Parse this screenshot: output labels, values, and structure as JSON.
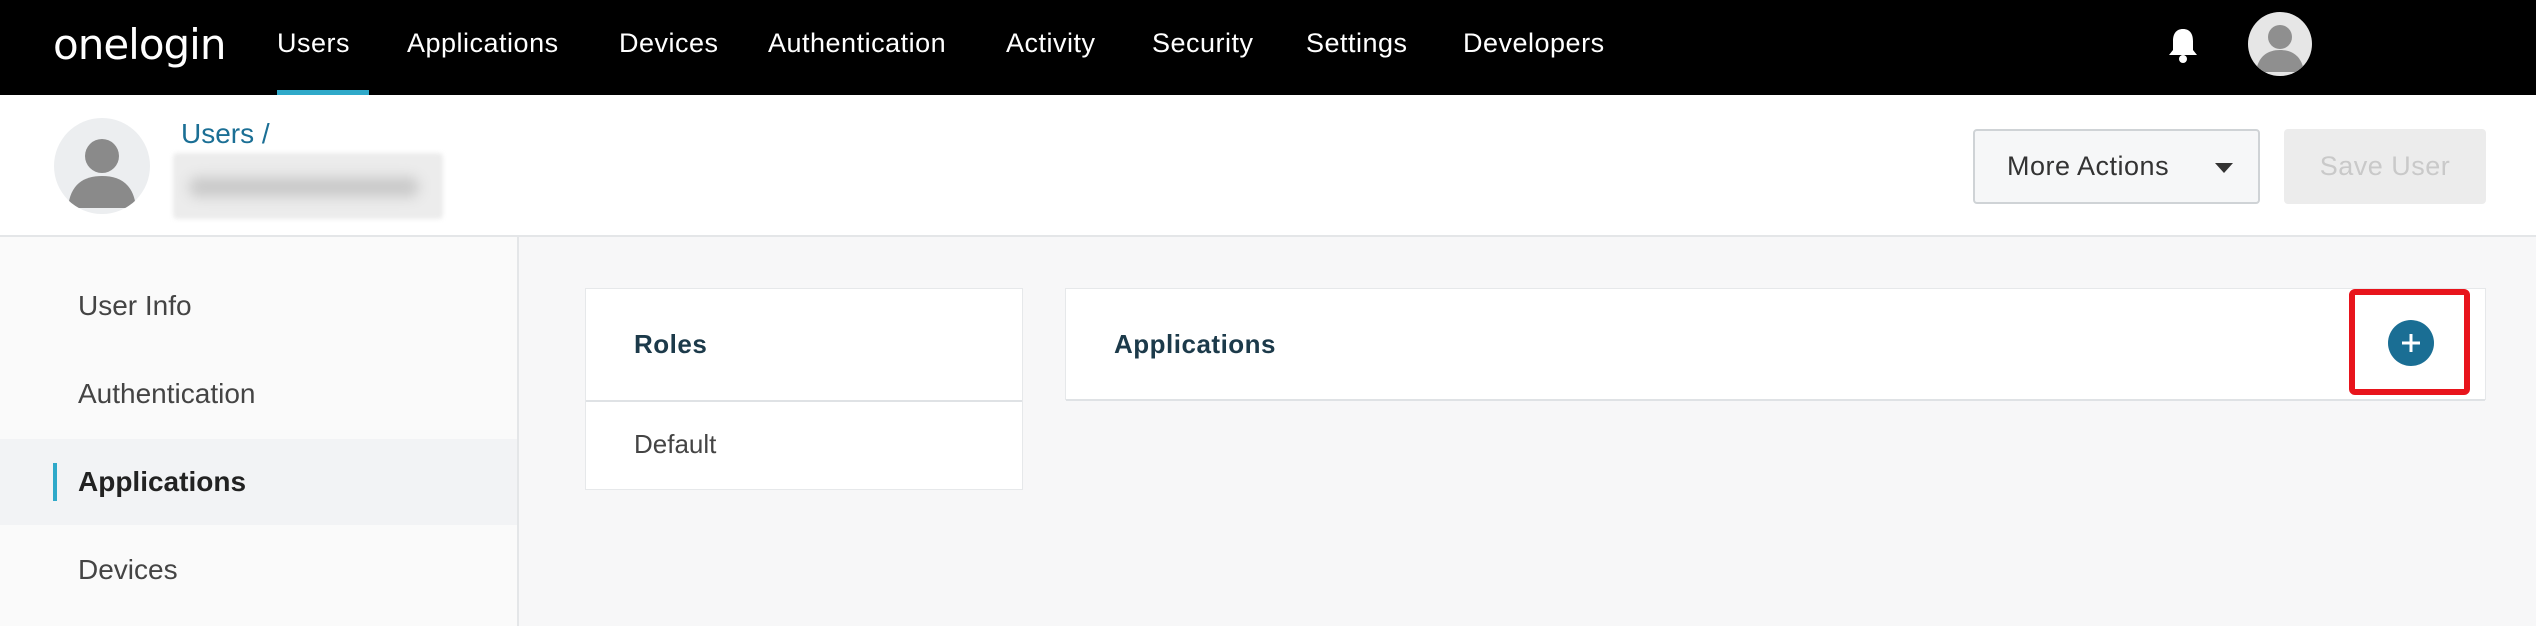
{
  "topnav": {
    "logo": "onelogin",
    "items": [
      {
        "label": "Users"
      },
      {
        "label": "Applications"
      },
      {
        "label": "Devices"
      },
      {
        "label": "Authentication"
      },
      {
        "label": "Activity"
      },
      {
        "label": "Security"
      },
      {
        "label": "Settings"
      },
      {
        "label": "Developers"
      }
    ],
    "active_item": "Users",
    "icons": [
      "bell-icon",
      "avatar-icon"
    ]
  },
  "header": {
    "breadcrumb": "Users /",
    "more_actions_label": "More Actions",
    "save_label": "Save User"
  },
  "sidebar": {
    "items": [
      {
        "label": "User Info"
      },
      {
        "label": "Authentication"
      },
      {
        "label": "Applications"
      },
      {
        "label": "Devices"
      }
    ],
    "active_item": "Applications"
  },
  "roles": {
    "title": "Roles",
    "items": [
      "Default"
    ]
  },
  "applications": {
    "title": "Applications"
  },
  "colors": {
    "accent": "#2fa9c9",
    "link": "#1b6f95",
    "add_button": "#1a6e94",
    "highlight": "#e8141c"
  }
}
